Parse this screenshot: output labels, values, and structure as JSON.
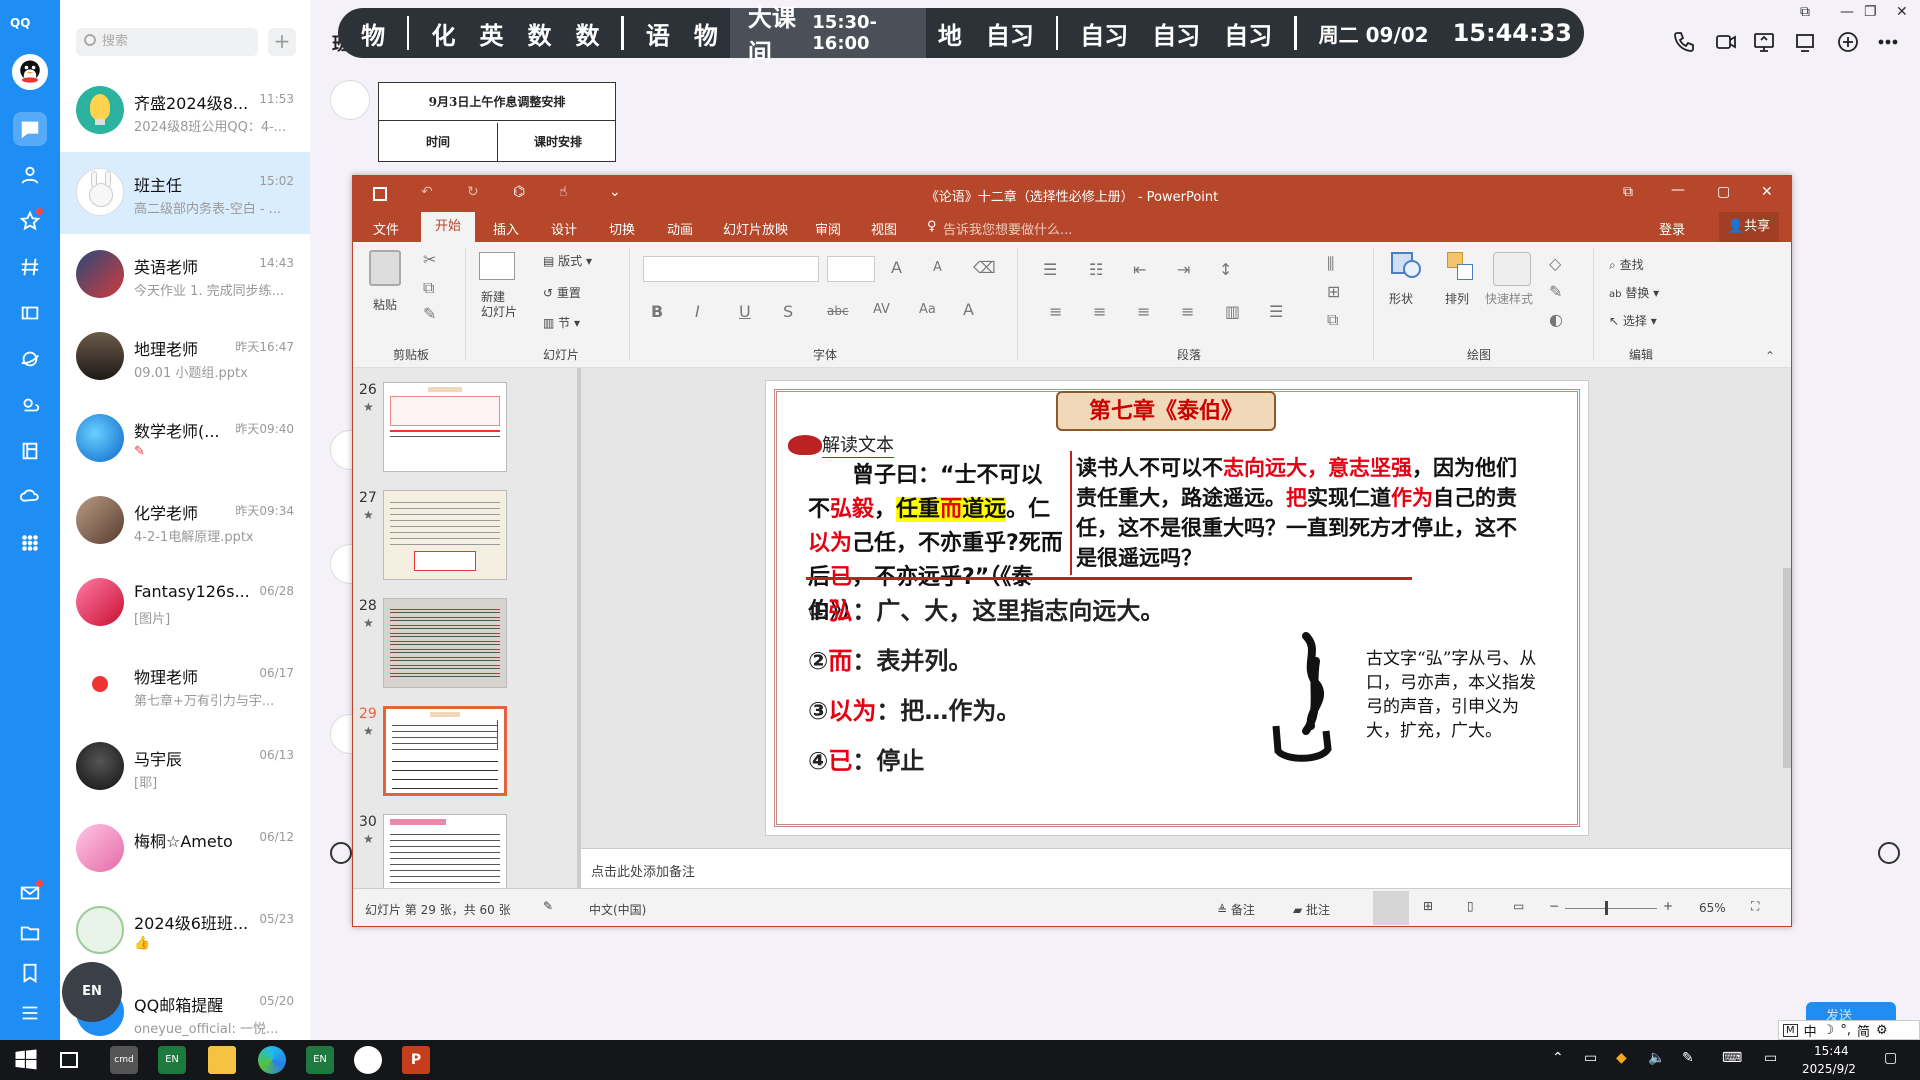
{
  "qq": {
    "logo": "QQ",
    "search_placeholder": "搜索",
    "add": "+",
    "chats": [
      {
        "name": "齐盛2024级8...",
        "time": "11:53",
        "preview": "2024级8班公用QQ：4-...",
        "active": false
      },
      {
        "name": "班主任",
        "time": "15:02",
        "preview": "高二级部内务表-空白 - ...",
        "active": true
      },
      {
        "name": "英语老师",
        "time": "14:43",
        "preview": "今天作业 1. 完成同步练...",
        "active": false
      },
      {
        "name": "地理老师",
        "time": "昨天16:47",
        "preview": "09.01 小题组.pptx",
        "active": false
      },
      {
        "name": "数学老师(...",
        "time": "昨天09:40",
        "preview": "✎",
        "active": false
      },
      {
        "name": "化学老师",
        "time": "昨天09:34",
        "preview": "4-2-1电解原理.pptx",
        "active": false
      },
      {
        "name": "Fantasy126s...",
        "time": "06/28",
        "preview": "[图片]",
        "active": false
      },
      {
        "name": "物理老师",
        "time": "06/17",
        "preview": "第七章+万有引力与宇...",
        "active": false
      },
      {
        "name": "马宇辰",
        "time": "06/13",
        "preview": "[耶]",
        "active": false
      },
      {
        "name": "梅桐☆Ameto",
        "time": "06/12",
        "preview": "",
        "active": false
      },
      {
        "name": "2024级6班班...",
        "time": "05/23",
        "preview": "👍",
        "active": false
      },
      {
        "name": "QQ邮箱提醒",
        "time": "05/20",
        "preview": "oneyue_official: 一悦...",
        "active": false
      }
    ],
    "chat_title": "班主任",
    "table_title": "9月3日上午作息调整安排",
    "table_col1": "时间",
    "table_col2": "课时安排",
    "send_label": "发送"
  },
  "schedule": {
    "seg1": [
      "物",
      "化",
      "英",
      "数",
      "数"
    ],
    "seg2": [
      "语",
      "物"
    ],
    "current": "大课间",
    "current_time": "15:30-16:00",
    "seg3": [
      "地",
      "自习"
    ],
    "seg4": [
      "自习",
      "自习",
      "自习"
    ],
    "date": "周二 09/02",
    "clock": "15:44:33"
  },
  "ppt": {
    "title": "《论语》十二章（选择性必修上册） - PowerPoint",
    "tabs": [
      "文件",
      "开始",
      "插入",
      "设计",
      "切换",
      "动画",
      "幻灯片放映",
      "审阅",
      "视图"
    ],
    "tell_me": "告诉我您想要做什么...",
    "login": "登录",
    "share": "共享",
    "groups": {
      "clipboard": "剪贴板",
      "paste": "粘贴",
      "slides": "幻灯片",
      "new_slide": "新建\n幻灯片",
      "layout": "版式",
      "reset": "重置",
      "section": "节",
      "font": "字体",
      "paragraph": "段落",
      "drawing": "绘图",
      "shape": "形状",
      "arrange": "排列",
      "quick_style": "快速样式",
      "editing": "编辑",
      "find": "查找",
      "replace": "替换",
      "select": "选择"
    },
    "thumbs": [
      "26",
      "27",
      "28",
      "29",
      "30"
    ],
    "notes_placeholder": "点击此处添加备注",
    "status_slide": "幻灯片 第 29 张，共 60 张",
    "status_lang": "中文(中国)",
    "status_notes": "备注",
    "status_comments": "批注",
    "zoom": "65%"
  },
  "slide": {
    "chapter": "第七章《泰伯》",
    "section": "解读文本",
    "left_text_parts": [
      {
        "t": "曾子曰：“士不可以不",
        "c": ""
      },
      {
        "t": "弘毅",
        "c": "red"
      },
      {
        "t": "，",
        "c": ""
      },
      {
        "t": "任重",
        "c": "hl"
      },
      {
        "t": "而",
        "c": "red hl"
      },
      {
        "t": "道远",
        "c": "hl"
      },
      {
        "t": "。仁",
        "c": ""
      },
      {
        "t": "以为",
        "c": "red"
      },
      {
        "t": "己任，不亦重乎?死而后",
        "c": ""
      },
      {
        "t": "已",
        "c": "red"
      },
      {
        "t": "，不亦远乎?”（《泰伯》）",
        "c": ""
      }
    ],
    "right_text_parts": [
      {
        "t": "读书人不可以不",
        "c": ""
      },
      {
        "t": "志向远大，意志坚强",
        "c": "red"
      },
      {
        "t": "，因为他们责任重大，路途遥远。",
        "c": ""
      },
      {
        "t": "把",
        "c": "red"
      },
      {
        "t": "实现仁道",
        "c": ""
      },
      {
        "t": "作为",
        "c": "red"
      },
      {
        "t": "自己的责任，这不是很重大吗？一直到死方才停止，这不是很遥远吗？",
        "c": ""
      }
    ],
    "notes": [
      {
        "num": "①",
        "key": "弘",
        "text": "：广、大，这里指志向远大。"
      },
      {
        "num": "②",
        "key": "而",
        "text": "：表并列。"
      },
      {
        "num": "③",
        "key": "以为",
        "text": "：把…作为。"
      },
      {
        "num": "④",
        "key": "已",
        "text": "：停止"
      }
    ],
    "glyph_note": "古文字“弘”字从弓、从口，弓亦声，本义指发弓的声音，引申义为大，扩充，广大。"
  },
  "taskbar": {
    "time": "15:44",
    "date": "2025/9/2",
    "ime": "中",
    "ime_lang": "简"
  },
  "colors": {
    "qq_blue": "#1e8ef5",
    "ppt_red": "#b7472a",
    "slide_red": "#e60012"
  }
}
